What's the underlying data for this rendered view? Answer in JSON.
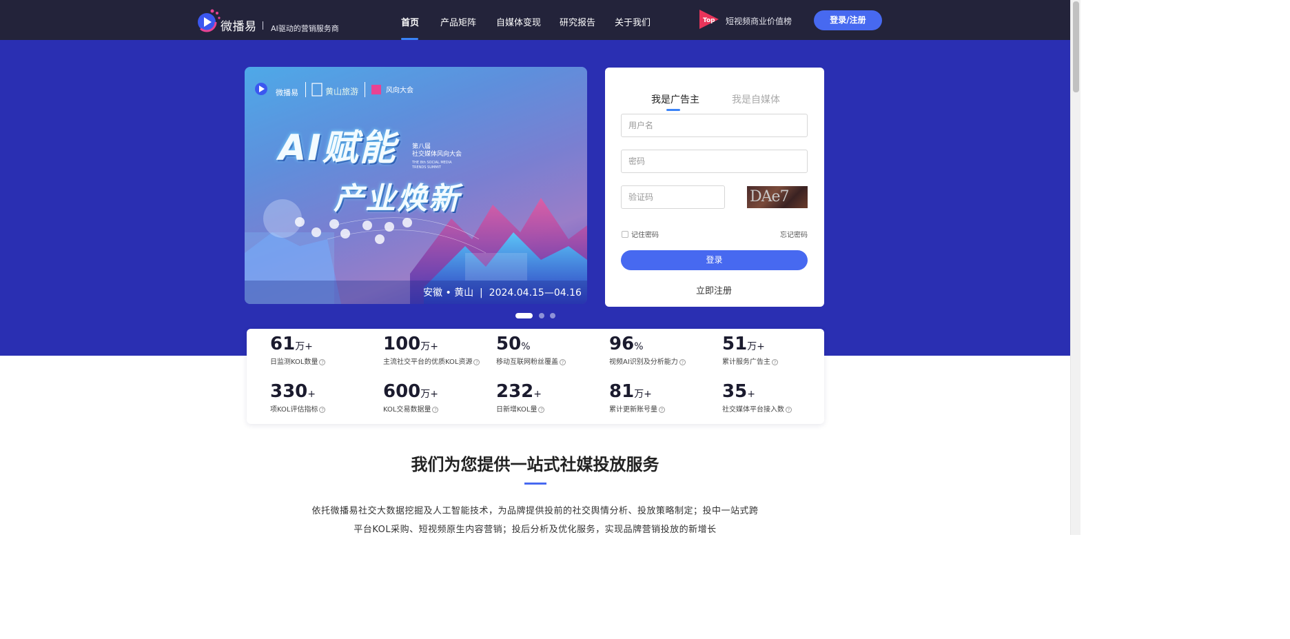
{
  "header": {
    "brand": "微播易",
    "tagline": "AI驱动的营销服务商",
    "nav": [
      "首页",
      "产品矩阵",
      "自媒体变现",
      "研究报告",
      "关于我们"
    ],
    "active_nav": "首页",
    "ranking_badge": "Top",
    "ranking_text": "短视频商业价值榜",
    "login_label": "登录/注册"
  },
  "banner": {
    "brand1": "微播易",
    "brand2": "黄山旅游",
    "brand3": "风向大会",
    "title_line1": "AI赋能",
    "title_line2": "产业焕新",
    "event_cn": "第八届\n社交媒体风向大会",
    "event_en": "THE 8th SOCIAL MEDIA\nTRENDS SUMMIT",
    "place_date": "安徽 • 黄山  |  2024.04.15—04.16",
    "slides": 3,
    "active_slide": 1
  },
  "login": {
    "tab_advertiser": "我是广告主",
    "tab_media": "我是自媒体",
    "username_placeholder": "用户名",
    "password_placeholder": "密码",
    "captcha_placeholder": "验证码",
    "captcha_text": "DAe7",
    "remember": "记住密码",
    "forgot": "忘记密码",
    "submit": "登录",
    "register": "立即注册"
  },
  "stats": [
    {
      "num": "61",
      "unit": "万+",
      "label": "日监测KOL数量"
    },
    {
      "num": "100",
      "unit": "万+",
      "label": "主流社交平台的优质KOL资源"
    },
    {
      "num": "50",
      "unit": "%",
      "label": "移动互联网粉丝覆盖"
    },
    {
      "num": "96",
      "unit": "%",
      "label": "视频AI识别及分析能力"
    },
    {
      "num": "51",
      "unit": "万+",
      "label": "累计服务广告主"
    },
    {
      "num": "330",
      "unit": "+",
      "label": "项KOL评估指标"
    },
    {
      "num": "600",
      "unit": "万+",
      "label": "KOL交易数据量"
    },
    {
      "num": "232",
      "unit": "+",
      "label": "日新增KOL量"
    },
    {
      "num": "81",
      "unit": "万+",
      "label": "累计更新账号量"
    },
    {
      "num": "35",
      "unit": "+",
      "label": "社交媒体平台接入数"
    }
  ],
  "service": {
    "title": "我们为您提供一站式社媒投放服务",
    "desc_line1": "依托微播易社交大数据挖掘及人工智能技术，为品牌提供投前的社交舆情分析、投放策略制定；投中一站式跨",
    "desc_line2": "平台KOL采购、短视频原生内容营销；投后分析及优化服务，实现品牌营销投放的新增长"
  },
  "colors": {
    "topbar": "#23233a",
    "hero": "#2a2fb2",
    "accent": "#4769f0",
    "tab_underline": "#3a82f7"
  }
}
